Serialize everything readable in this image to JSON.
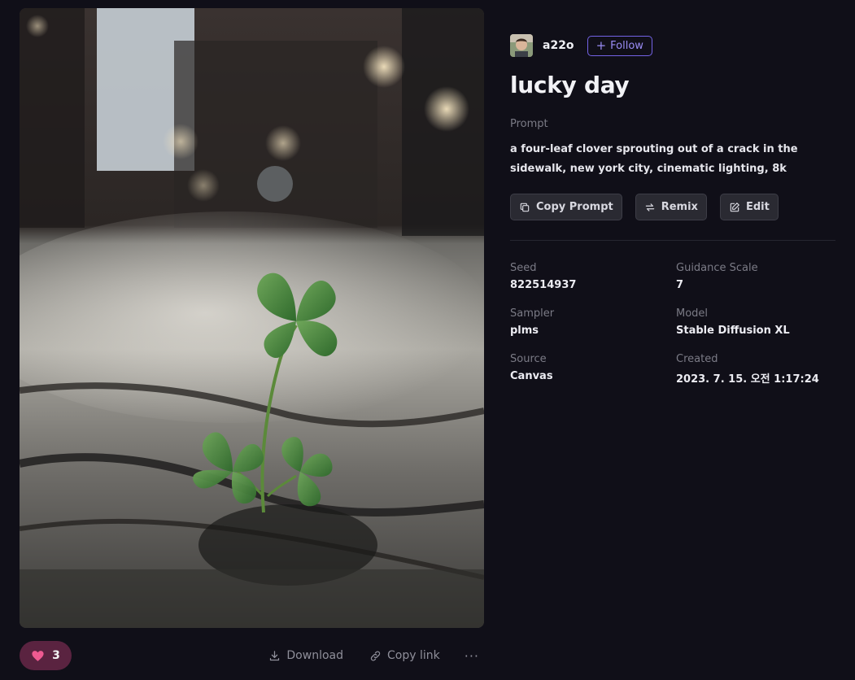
{
  "image": {
    "alt": "a four-leaf clover sprouting out of a crack in the sidewalk"
  },
  "author": {
    "username": "a22o",
    "follow_label": "Follow",
    "follow_icon": "plus-icon"
  },
  "title": "lucky day",
  "prompt": {
    "label": "Prompt",
    "text": "a four-leaf clover sprouting out of a crack in the sidewalk, new york city, cinematic lighting, 8k"
  },
  "actions": [
    {
      "label": "Copy Prompt",
      "icon": "copy-icon"
    },
    {
      "label": "Remix",
      "icon": "remix-icon"
    },
    {
      "label": "Edit",
      "icon": "edit-icon"
    }
  ],
  "meta": {
    "seed": {
      "label": "Seed",
      "value": "822514937"
    },
    "guidance": {
      "label": "Guidance Scale",
      "value": "7"
    },
    "sampler": {
      "label": "Sampler",
      "value": "plms"
    },
    "model": {
      "label": "Model",
      "value": "Stable Diffusion XL"
    },
    "source": {
      "label": "Source",
      "value": "Canvas"
    },
    "created": {
      "label": "Created",
      "value": "2023. 7. 15. 오전 1:17:24"
    }
  },
  "bottom_bar": {
    "like_count": "3",
    "download_label": "Download",
    "copy_link_label": "Copy link",
    "more_label": "···"
  },
  "colors": {
    "background": "#100f18",
    "accent": "#7463e6",
    "like_bg": "#5a2340",
    "like_heart": "#ee5a91"
  }
}
